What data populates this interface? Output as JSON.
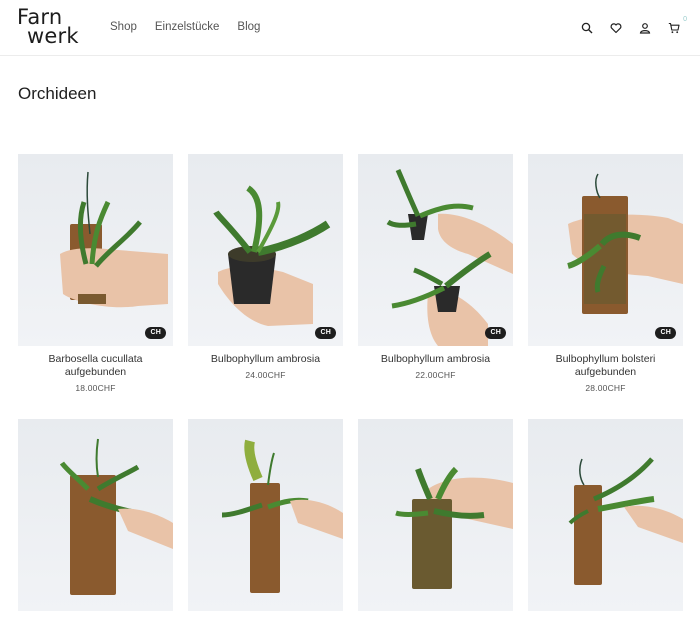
{
  "brand": {
    "line1": "Farn",
    "line2": "werk"
  },
  "nav": [
    {
      "label": "Shop"
    },
    {
      "label": "Einzelstücke"
    },
    {
      "label": "Blog"
    }
  ],
  "header_icons": [
    "search-icon",
    "heart-icon",
    "user-icon",
    "cart-icon"
  ],
  "cart_count": "0",
  "page_title": "Orchideen",
  "products": [
    {
      "name": "Barbosella cucullata aufgebunden",
      "price": "18.00CHF",
      "badge": "CH"
    },
    {
      "name": "Bulbophyllum ambrosia",
      "price": "24.00CHF",
      "badge": "CH"
    },
    {
      "name": "Bulbophyllum ambrosia",
      "price": "22.00CHF",
      "badge": "CH"
    },
    {
      "name": "Bulbophyllum bolsteri aufgebunden",
      "price": "28.00CHF",
      "badge": "CH"
    },
    {
      "name": "",
      "price": "",
      "badge": ""
    },
    {
      "name": "",
      "price": "",
      "badge": ""
    },
    {
      "name": "",
      "price": "",
      "badge": ""
    },
    {
      "name": "",
      "price": "",
      "badge": ""
    }
  ],
  "colors": {
    "leaf": "#3f7a2e",
    "bark": "#8a5a2e",
    "skin": "#e9c3a8",
    "pot": "#2a2a2a",
    "badge": "#1d1d1d"
  }
}
